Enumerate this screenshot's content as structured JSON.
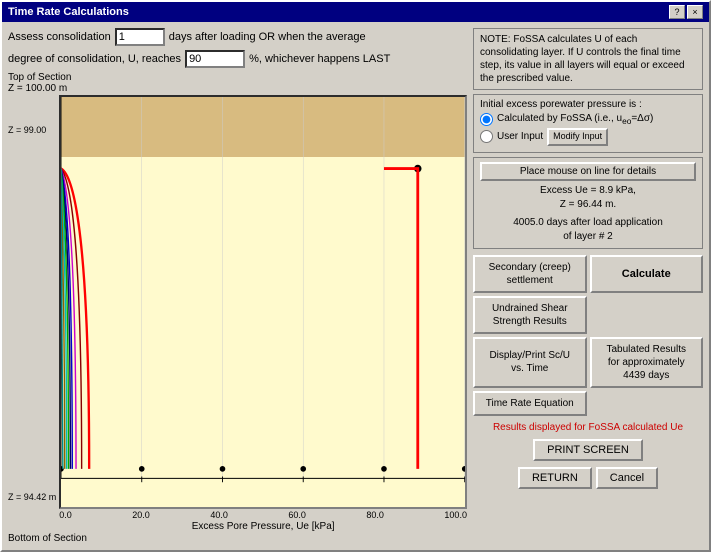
{
  "window": {
    "title": "Time Rate Calculations",
    "close_btn": "×",
    "help_btn": "?",
    "minimize_btn": "_"
  },
  "top_controls": {
    "label1": "Assess consolidation",
    "days_value": "1",
    "label2": "days after loading  OR  when the  average",
    "label3": "degree of consolidation, U, reaches",
    "percent_value": "90",
    "label4": "%,  whichever happens LAST"
  },
  "chart": {
    "top_label": "Top of Section",
    "z_top_label": "Z = 100.00 m",
    "z_middle_label": "Z = 99.00",
    "z_bottom_label": "Z = 94.42 m",
    "bottom_section_label": "Bottom of Section",
    "x_axis_start": "0.0",
    "x_axis_labels": [
      "20.0",
      "40.0",
      "60.0",
      "80.0",
      "100.0"
    ],
    "x_axis_title": "Excess Pore Pressure, Ue  [kPa]"
  },
  "note": {
    "text": "NOTE:  FoSSA calculates U of each consolidating layer. If U controls the final time step, its value in all layers will equal or exceed the prescribed value."
  },
  "radio_group": {
    "title": "Initial excess porewater pressure is :",
    "option1": "Calculated by FoSSA  (i.e., u₀ₐ=Δσ)",
    "option2": "User Input",
    "option1_selected": true,
    "modify_btn": "Modify Input"
  },
  "mouse_info": {
    "btn_label": "Place mouse on line for details",
    "excess_ue": "Excess Ue = 8.9 kPa,",
    "z_value": "Z = 96.44 m.",
    "days_info": "4005.0  days after load application",
    "layer_info": "of layer # 2"
  },
  "buttons": {
    "secondary_settlement": "Secondary (creep)\nsettlement",
    "calculate": "Calculate",
    "undrained_shear": "Undrained Shear\nStrength Results",
    "display_sc_u": "Display/Print Sc/U\nvs. Time",
    "tabulated_results": "Tabulated Results\nfor approximately\n4439 days",
    "time_rate_equation": "Time Rate Equation"
  },
  "bottom": {
    "status_text": "Results displayed for FoSSA calculated Ue",
    "print_btn": "PRINT SCREEN",
    "return_btn": "RETURN",
    "cancel_btn": "Cancel"
  }
}
